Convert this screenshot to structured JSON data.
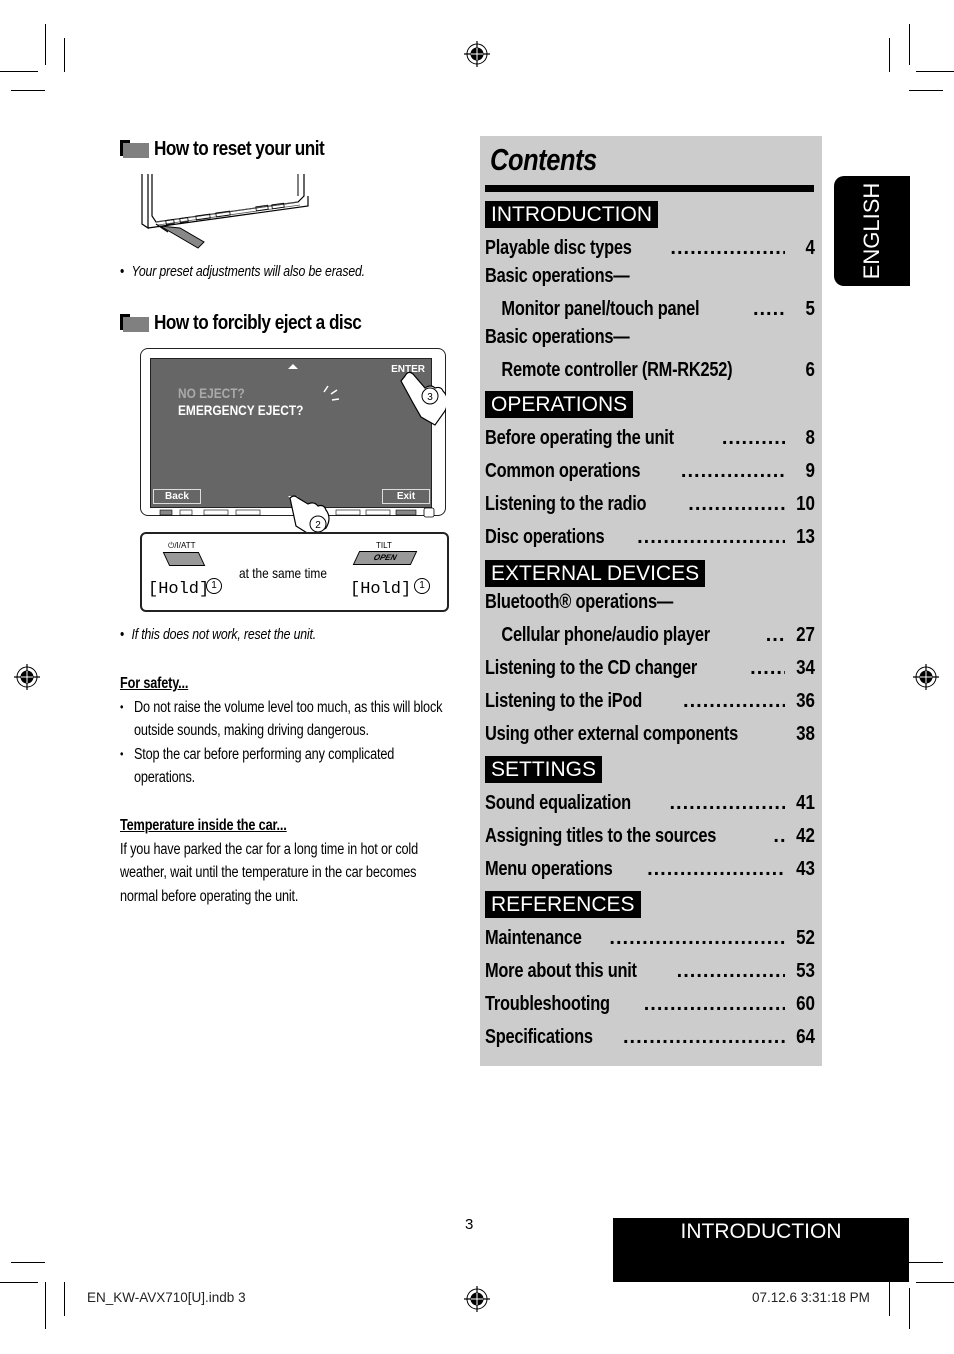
{
  "left_column": {
    "reset_section": {
      "title": "How to reset your unit",
      "note": "Your preset adjustments will also be erased."
    },
    "eject_section": {
      "title": "How to forcibly eject a disc",
      "screen": {
        "line1": "NO EJECT?",
        "line2": "EMERGENCY EJECT?",
        "enter_label": "ENTER",
        "back_label": "Back",
        "exit_label": "Exit"
      },
      "hold_panel": {
        "left_button_label": "⏻/I/ATT",
        "right_button_top_label": "TILT",
        "right_button_label": "OPEN",
        "hold_label": "[Hold]",
        "same_time_label": "at the same time",
        "step1": "1",
        "step2": "2",
        "step3": "3"
      },
      "note": "If this does not work, reset the unit."
    },
    "safety": {
      "heading": "For safety...",
      "bullets": [
        "Do not raise the volume level too much, as this will block outside sounds, making driving dangerous.",
        "Stop the car before performing any complicated operations."
      ]
    },
    "temperature": {
      "heading": "Temperature inside the car...",
      "text": "If you have parked the car for a long time in hot or cold weather, wait until the temperature in the car becomes normal before operating the unit."
    }
  },
  "contents": {
    "title": "Contents",
    "categories": [
      {
        "label": "INTRODUCTION",
        "items": [
          {
            "text": "Playable disc types",
            "page": "4"
          },
          {
            "line1": "Basic operations—",
            "text": "Monitor panel/touch panel",
            "page": "5"
          },
          {
            "line1": "Basic operations—",
            "text": "Remote controller (RM-RK252)",
            "page": "6"
          }
        ]
      },
      {
        "label": "OPERATIONS",
        "items": [
          {
            "text": "Before operating the unit",
            "page": "8"
          },
          {
            "text": "Common operations",
            "page": "9"
          },
          {
            "text": "Listening to the radio",
            "page": "10"
          },
          {
            "text": "Disc operations",
            "page": "13"
          }
        ]
      },
      {
        "label": "EXTERNAL DEVICES",
        "items": [
          {
            "line1": "Bluetooth® operations—",
            "text": "Cellular phone/audio player",
            "page": "27"
          },
          {
            "text": "Listening to the CD changer",
            "page": "34"
          },
          {
            "text": "Listening to the iPod",
            "page": "36"
          },
          {
            "text": "Using other external components",
            "page": "38"
          }
        ]
      },
      {
        "label": "SETTINGS",
        "items": [
          {
            "text": "Sound equalization",
            "page": "41"
          },
          {
            "text": "Assigning titles to the sources",
            "page": "42"
          },
          {
            "text": "Menu operations",
            "page": "43"
          }
        ]
      },
      {
        "label": "REFERENCES",
        "items": [
          {
            "text": "Maintenance",
            "page": "52"
          },
          {
            "text": "More about this unit",
            "page": "53"
          },
          {
            "text": "Troubleshooting",
            "page": "60"
          },
          {
            "text": "Specifications",
            "page": "64"
          }
        ]
      }
    ]
  },
  "language_tab": "ENGLISH",
  "footer": {
    "page_number": "3",
    "section_tab": "INTRODUCTION",
    "slug_file": "EN_KW-AVX710[U].indb   3",
    "slug_timestamp": "07.12.6   3:31:18 PM"
  }
}
